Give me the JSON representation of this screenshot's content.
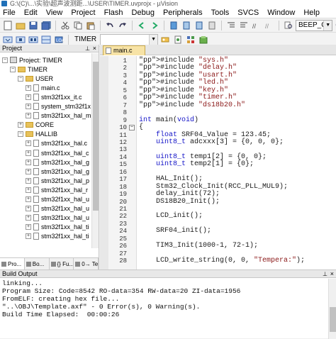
{
  "window": {
    "title": "G:\\(C)\\...\\实验\\超声波测距...\\USER\\TIMER.uvprojx - µVision"
  },
  "menu": [
    "File",
    "Edit",
    "View",
    "Project",
    "Flash",
    "Debug",
    "Peripherals",
    "Tools",
    "SVCS",
    "Window",
    "Help"
  ],
  "toolbar": {
    "target_name": "TIMER",
    "find_value": "BEEP_ON"
  },
  "project_panel": {
    "title": "Project",
    "tree": [
      {
        "label": "Project: TIMER",
        "level": 0,
        "type": "project",
        "expander": "−"
      },
      {
        "label": "TIMER",
        "level": 1,
        "type": "folder",
        "expander": "−"
      },
      {
        "label": "USER",
        "level": 2,
        "type": "folder",
        "expander": "−"
      },
      {
        "label": "main.c",
        "level": 3,
        "type": "file",
        "expander": "+"
      },
      {
        "label": "stm32f1xx_it.c",
        "level": 3,
        "type": "file",
        "expander": "+"
      },
      {
        "label": "system_stm32f1x",
        "level": 3,
        "type": "file",
        "expander": "+"
      },
      {
        "label": "stm32f1xx_hal_m",
        "level": 3,
        "type": "file",
        "expander": "+"
      },
      {
        "label": "CORE",
        "level": 2,
        "type": "folder",
        "expander": "+"
      },
      {
        "label": "HALLIB",
        "level": 2,
        "type": "folder",
        "expander": "−"
      },
      {
        "label": "stm32f1xx_hal.c",
        "level": 3,
        "type": "file",
        "expander": "+"
      },
      {
        "label": "stm32f1xx_hal_c",
        "level": 3,
        "type": "file",
        "expander": "+"
      },
      {
        "label": "stm32f1xx_hal_g",
        "level": 3,
        "type": "file",
        "expander": "+"
      },
      {
        "label": "stm32f1xx_hal_g",
        "level": 3,
        "type": "file",
        "expander": "+"
      },
      {
        "label": "stm32f1xx_hal_p",
        "level": 3,
        "type": "file",
        "expander": "+"
      },
      {
        "label": "stm32f1xx_hal_r",
        "level": 3,
        "type": "file",
        "expander": "+"
      },
      {
        "label": "stm32f1xx_hal_u",
        "level": 3,
        "type": "file",
        "expander": "+"
      },
      {
        "label": "stm32f1xx_hal_u",
        "level": 3,
        "type": "file",
        "expander": "+"
      },
      {
        "label": "stm32f1xx_hal_u",
        "level": 3,
        "type": "file",
        "expander": "+"
      },
      {
        "label": "stm32f1xx_hal_ti",
        "level": 3,
        "type": "file",
        "expander": "+"
      },
      {
        "label": "stm32f1xx_hal_ti",
        "level": 3,
        "type": "file",
        "expander": "+"
      }
    ],
    "tabs": [
      "Pro...",
      "Bo...",
      "{} Fu...",
      "0→ Te..."
    ]
  },
  "editor": {
    "active_tab": "main.c",
    "lines": [
      {
        "n": "1",
        "code": "#include \"sys.h\""
      },
      {
        "n": "2",
        "code": "#include \"delay.h\""
      },
      {
        "n": "3",
        "code": "#include \"usart.h\""
      },
      {
        "n": "4",
        "code": "#include \"led.h\""
      },
      {
        "n": "5",
        "code": "#include \"key.h\""
      },
      {
        "n": "6",
        "code": "#include \"timer.h\""
      },
      {
        "n": "7",
        "code": "#include \"ds18b20.h\""
      },
      {
        "n": "8",
        "code": ""
      },
      {
        "n": "9",
        "code": "int main(void)"
      },
      {
        "n": "10",
        "code": "{",
        "fold": "−"
      },
      {
        "n": "11",
        "code": "    float SRF04_Value = 123.45;"
      },
      {
        "n": "12",
        "code": "    uint8_t adcxxx[3] = {0, 0, 0};"
      },
      {
        "n": "13",
        "code": ""
      },
      {
        "n": "14",
        "code": "    uint8_t temp1[2] = {0, 0};"
      },
      {
        "n": "15",
        "code": "    uint8_t temp2[1] = {0};"
      },
      {
        "n": "16",
        "code": ""
      },
      {
        "n": "17",
        "code": "    HAL_Init();"
      },
      {
        "n": "18",
        "code": "    Stm32_Clock_Init(RCC_PLL_MUL9);"
      },
      {
        "n": "19",
        "code": "    delay_init(72);"
      },
      {
        "n": "20",
        "code": "    DS18B20_Init();"
      },
      {
        "n": "21",
        "code": ""
      },
      {
        "n": "22",
        "code": "    LCD_init();"
      },
      {
        "n": "23",
        "code": ""
      },
      {
        "n": "24",
        "code": "    SRF04_init();"
      },
      {
        "n": "25",
        "code": ""
      },
      {
        "n": "26",
        "code": "    TIM3_Init(1000-1, 72-1);"
      },
      {
        "n": "27",
        "code": ""
      },
      {
        "n": "28",
        "code": "    LCD_write_string(0, 0, \"Tempera:\");"
      }
    ]
  },
  "build_output": {
    "title": "Build Output",
    "lines": [
      "linking...",
      "Program Size: Code=8542 RO-data=354 RW-data=20 ZI-data=1956",
      "FromELF: creating hex file...",
      "\"..\\OBJ\\Template.axf\" - 0 Error(s), 0 Warning(s).",
      "Build Time Elapsed:  00:00:26"
    ]
  }
}
